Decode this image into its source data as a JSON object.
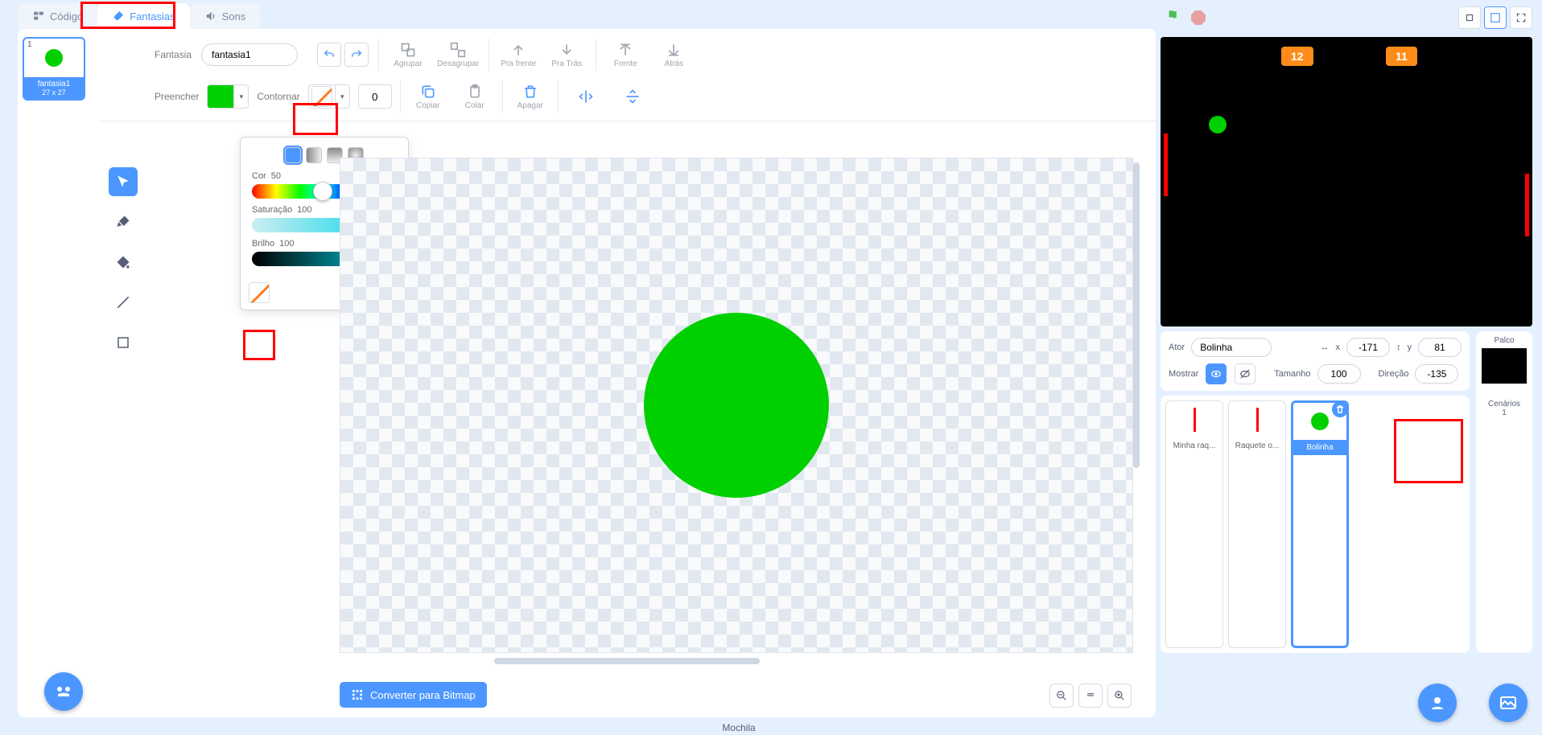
{
  "tabs": {
    "code": "Código",
    "costumes": "Fantasias",
    "sounds": "Sons"
  },
  "costume_thumb": {
    "num": "1",
    "name": "fantasia1",
    "dims": "27 x 27"
  },
  "toolbar": {
    "costume_label": "Fantasia",
    "costume_value": "fantasia1",
    "group": "Agrupar",
    "ungroup": "Desagrupar",
    "forward": "Pra frente",
    "backward": "Pra Trás",
    "front": "Frente",
    "back": "Atrás",
    "fill": "Preencher",
    "outline": "Contornar",
    "outline_width": "0",
    "copy": "Copiar",
    "paste": "Colar",
    "delete": "Apagar",
    "convert": "Converter para Bitmap"
  },
  "color_popover": {
    "hue_label": "Cor",
    "hue_val": "50",
    "sat_label": "Saturação",
    "sat_val": "100",
    "bri_label": "Brilho",
    "bri_val": "100"
  },
  "stage": {
    "score_left": "12",
    "score_right": "11"
  },
  "sprite_info": {
    "actor_label": "Ator",
    "actor_name": "Bolinha",
    "x_label": "x",
    "x_val": "-171",
    "y_label": "y",
    "y_val": "81",
    "show_label": "Mostrar",
    "size_label": "Tamanho",
    "size_val": "100",
    "dir_label": "Direção",
    "dir_val": "-135"
  },
  "stage_panel": {
    "title": "Palco",
    "backdrops_label": "Cenários",
    "backdrops_count": "1"
  },
  "sprites": [
    {
      "name": "Minha raq..."
    },
    {
      "name": "Raquete o..."
    },
    {
      "name": "Bolinha"
    }
  ],
  "backpack": "Mochila"
}
